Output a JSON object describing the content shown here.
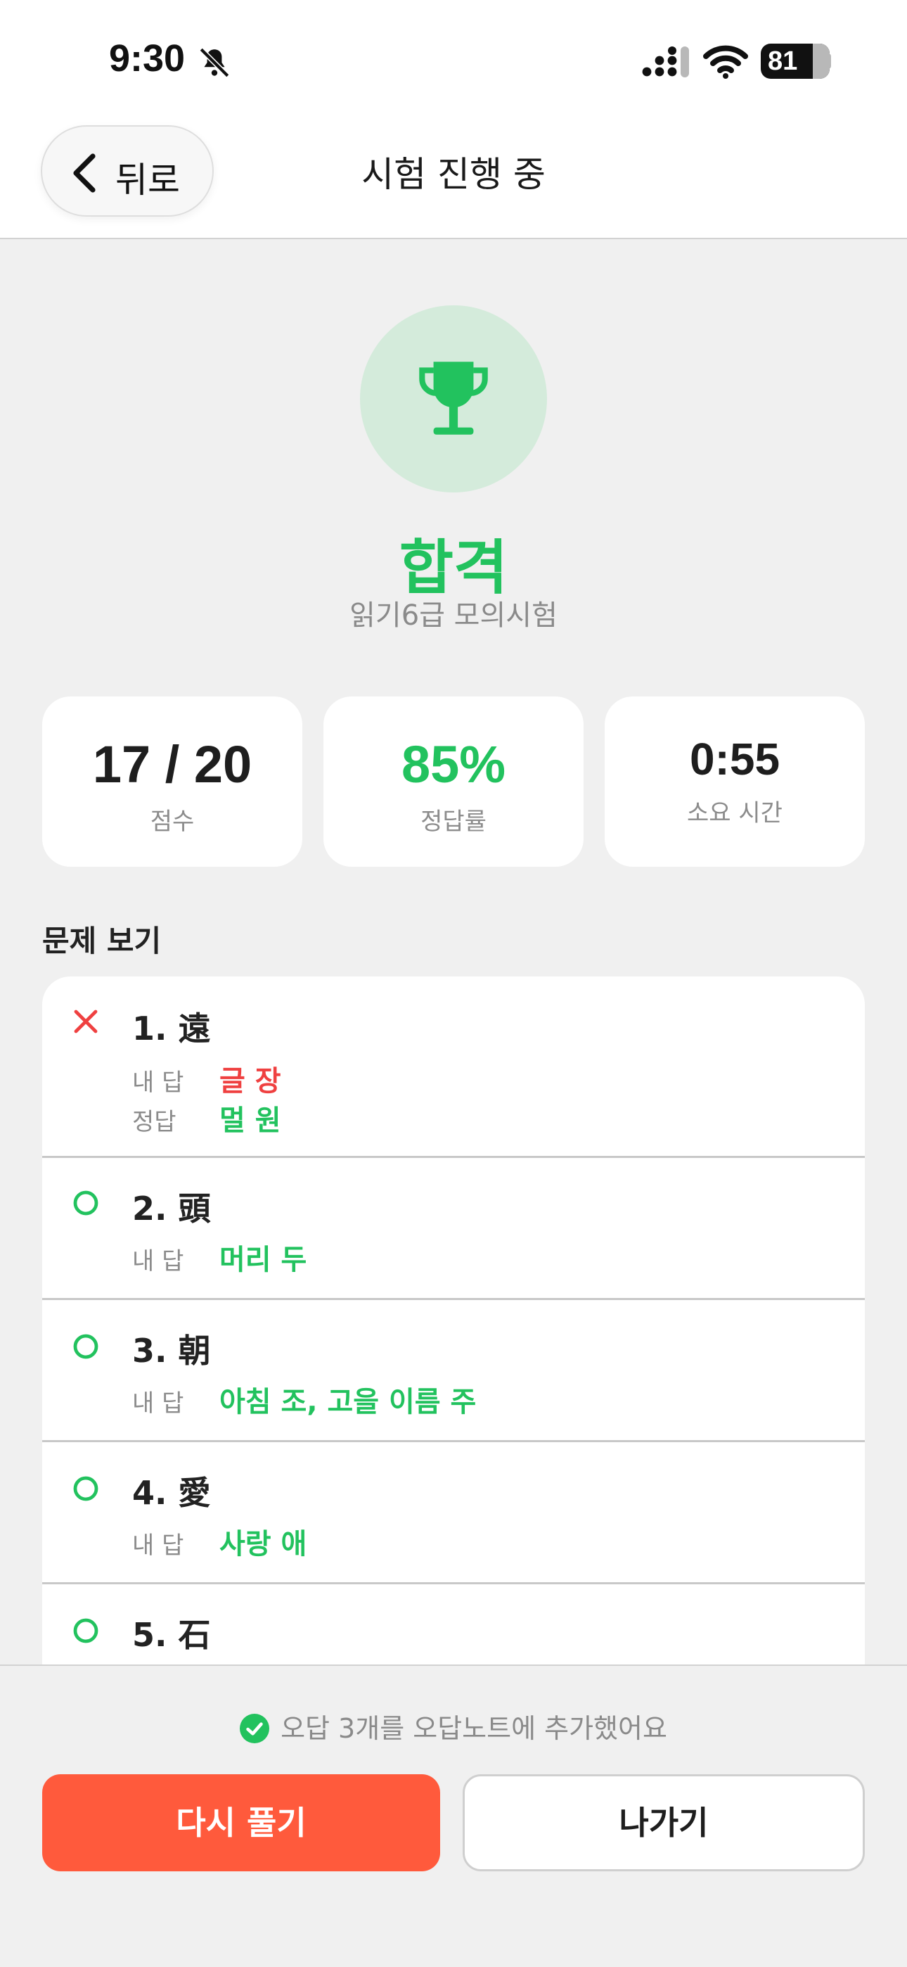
{
  "status": {
    "time": "9:30",
    "battery": "81"
  },
  "nav": {
    "back_label": "뒤로",
    "title": "시험 진행 중"
  },
  "result": {
    "title": "합격",
    "subtitle": "읽기6급 모의시험"
  },
  "stats": [
    {
      "value": "17 / 20",
      "label": "점수"
    },
    {
      "value": "85%",
      "label": "정답률"
    },
    {
      "value": "0:55",
      "label": "소요 시간"
    }
  ],
  "section_title": "문제 보기",
  "questions": [
    {
      "title": "1. 遠",
      "correct": false,
      "my_key": "내 답",
      "my_answer": "글 장",
      "answer_key": "정답",
      "answer": "멀 원"
    },
    {
      "title": "2. 頭",
      "correct": true,
      "my_key": "내 답",
      "my_answer": "머리 두"
    },
    {
      "title": "3. 朝",
      "correct": true,
      "my_key": "내 답",
      "my_answer": "아침 조, 고을 이름 주"
    },
    {
      "title": "4. 愛",
      "correct": true,
      "my_key": "내 답",
      "my_answer": "사랑 애"
    },
    {
      "title": "5. 石",
      "correct": true
    }
  ],
  "notice": "오답 3개를 오답노트에 추가했어요",
  "buttons": {
    "retry": "다시 풀기",
    "exit": "나가기"
  },
  "colors": {
    "success": "#22c25e",
    "error": "#ef4040",
    "primary": "#ff5a3c"
  }
}
